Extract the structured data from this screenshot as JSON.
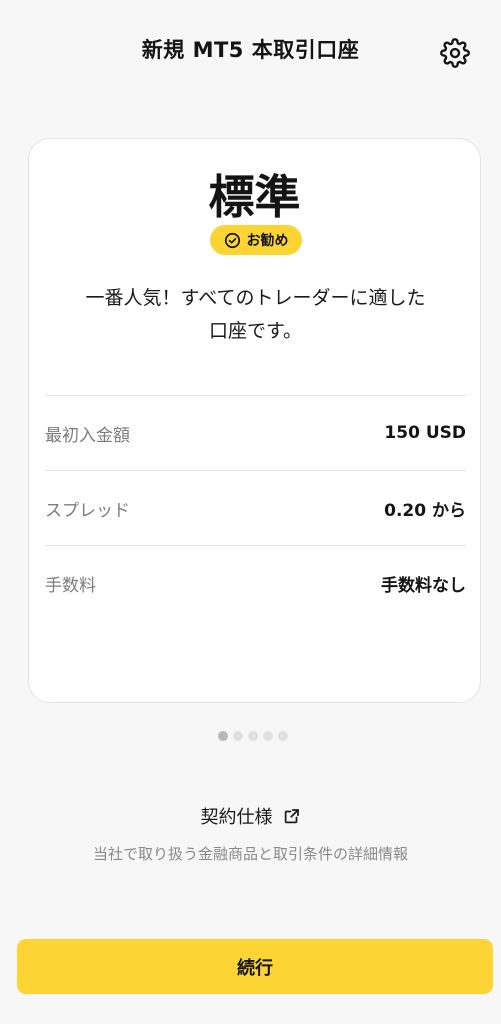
{
  "header": {
    "title": "新規 MT5 本取引口座",
    "settings_icon": "gear-icon"
  },
  "card": {
    "title": "標準",
    "badge": {
      "icon": "check-circle-icon",
      "label": "お勧め"
    },
    "description_line1": "一番人気！すべてのトレーダーに適した",
    "description_line2": "口座です。",
    "rows": [
      {
        "label": "最初入金額",
        "value": "150 USD"
      },
      {
        "label": "スプレッド",
        "value": "0.20 から"
      },
      {
        "label": "手数料",
        "value": "手数料なし"
      }
    ]
  },
  "pagination": {
    "total": 5,
    "active": 1
  },
  "spec": {
    "link_label": "契約仕様",
    "link_icon": "external-link-icon",
    "description": "当社で取り扱う金融商品と取引条件の詳細情報"
  },
  "footer": {
    "continue_label": "続行"
  },
  "colors": {
    "accent": "#fcd535",
    "background": "#f7f7f7",
    "card": "#ffffff",
    "muted_text": "#7c7c7c"
  }
}
